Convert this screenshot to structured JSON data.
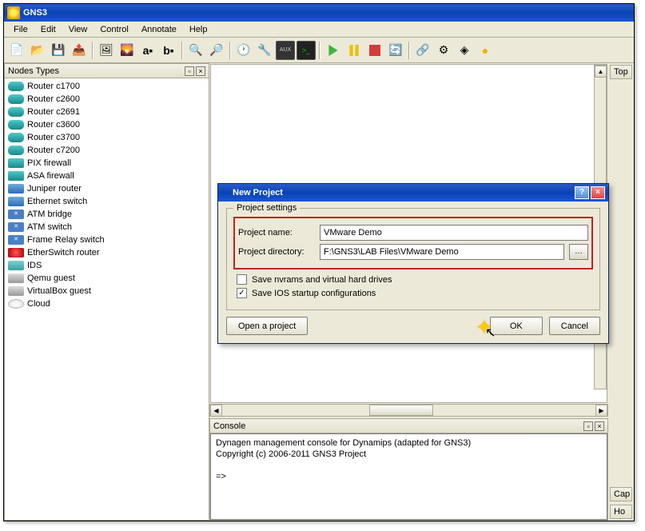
{
  "app": {
    "title": "GNS3"
  },
  "menu": {
    "file": "File",
    "edit": "Edit",
    "view": "View",
    "control": "Control",
    "annotate": "Annotate",
    "help": "Help"
  },
  "panels": {
    "nodes_title": "Nodes Types",
    "console_title": "Console",
    "top_tab": "Top",
    "cap_tab": "Cap",
    "ho_tab": "Ho"
  },
  "nodes": [
    {
      "label": "Router c1700",
      "icon": "router-ic"
    },
    {
      "label": "Router c2600",
      "icon": "router-ic"
    },
    {
      "label": "Router c2691",
      "icon": "router-ic"
    },
    {
      "label": "Router c3600",
      "icon": "router-ic"
    },
    {
      "label": "Router c3700",
      "icon": "router-ic"
    },
    {
      "label": "Router c7200",
      "icon": "router-ic"
    },
    {
      "label": "PIX firewall",
      "icon": "fire-ic"
    },
    {
      "label": "ASA firewall",
      "icon": "fire-ic"
    },
    {
      "label": "Juniper router",
      "icon": "switch-ic"
    },
    {
      "label": "Ethernet switch",
      "icon": "switch-ic"
    },
    {
      "label": "ATM bridge",
      "icon": "atm-ic"
    },
    {
      "label": "ATM switch",
      "icon": "atm-ic"
    },
    {
      "label": "Frame Relay switch",
      "icon": "atm-ic"
    },
    {
      "label": "EtherSwitch router",
      "icon": "eswitch-ic"
    },
    {
      "label": "IDS",
      "icon": "ids-ic"
    },
    {
      "label": "Qemu guest",
      "icon": "guest-ic"
    },
    {
      "label": "VirtualBox guest",
      "icon": "guest-ic"
    },
    {
      "label": "Cloud",
      "icon": "cloud-ic"
    }
  ],
  "dialog": {
    "title": "New Project",
    "legend": "Project settings",
    "name_label": "Project name:",
    "name_value": "VMware Demo",
    "dir_label": "Project directory:",
    "dir_value": "F:\\GNS3\\LAB Files\\VMware Demo",
    "save_nvrams": "Save nvrams and virtual hard drives",
    "save_ios": "Save IOS startup configurations",
    "open_btn": "Open a project",
    "ok_btn": "OK",
    "cancel_btn": "Cancel"
  },
  "console": {
    "line1": "Dynagen management console for Dynamips (adapted for GNS3)",
    "line2": "Copyright (c) 2006-2011 GNS3 Project",
    "prompt": "=>"
  }
}
